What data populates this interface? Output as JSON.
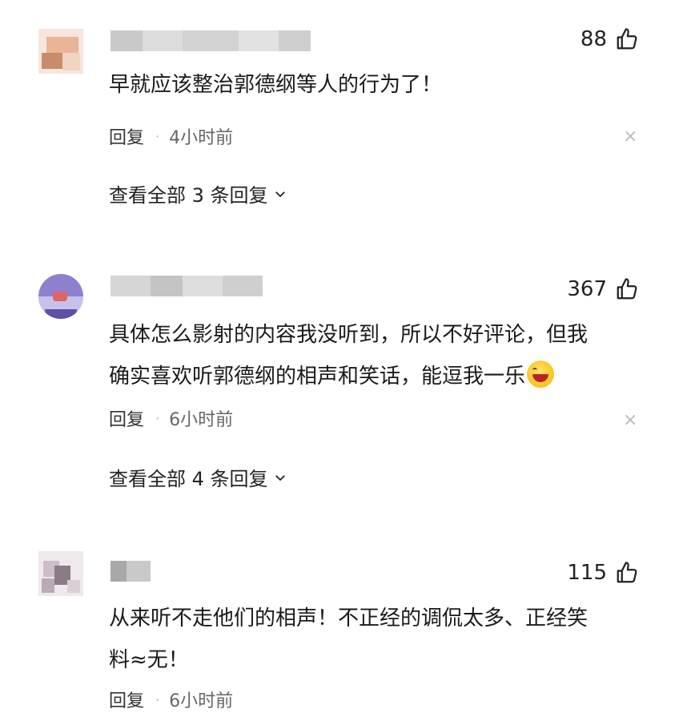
{
  "comments": [
    {
      "likes": "88",
      "text": "早就应该整治郭德纲等人的行为了！",
      "reply_label": "回复",
      "separator": "·",
      "time": "4小时前",
      "view_all": "查看全部 3 条回复",
      "avatar_colors": [
        "#f3d8cc",
        "#e8b89a",
        "#c99a7a",
        "#f1e4dc"
      ]
    },
    {
      "likes": "367",
      "text_line1": "具体怎么影射的内容我没听到，所以不好评论，但我",
      "text_line2": "确实喜欢听郭德纲的相声和笑话，能逗我一乐",
      "emoji": "laughing-face",
      "reply_label": "回复",
      "separator": "·",
      "time": "6小时前",
      "view_all": "查看全部 4 条回复",
      "avatar_colors": [
        "#8a7bc8",
        "#c9c0ea",
        "#6c5fb2",
        "#e36a6a"
      ]
    },
    {
      "likes": "115",
      "text_line1": "从来听不走他们的相声！不正经的调侃太多、正经笑",
      "text_line2": "料≈无！",
      "reply_label": "回复",
      "separator": "·",
      "time": "6小时前",
      "avatar_colors": [
        "#d8d0da",
        "#8b7d88",
        "#c5b8c2",
        "#efe9ee"
      ]
    }
  ],
  "colors": {
    "accent": "#222222",
    "muted": "#666666",
    "close": "#bbbbbb"
  }
}
